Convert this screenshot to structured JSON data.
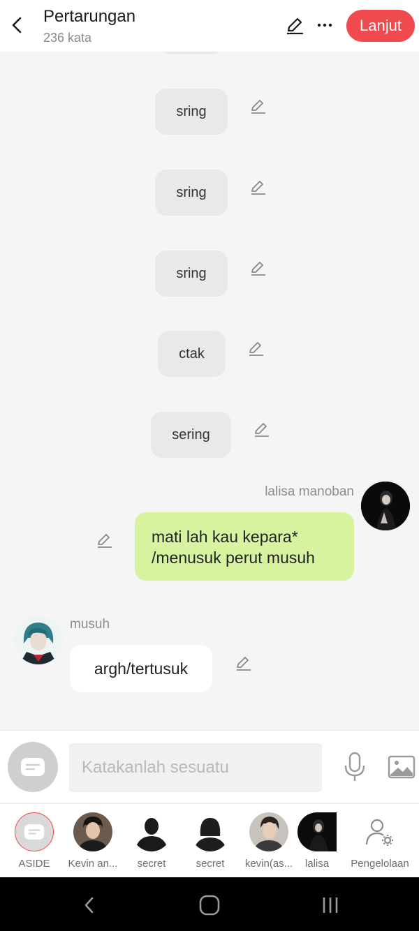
{
  "header": {
    "title": "Pertarungan",
    "word_count": "236 kata",
    "next_label": "Lanjut",
    "accent_color": "#ef4a4e"
  },
  "messages": {
    "sfx": [
      "sring",
      "sring",
      "sring",
      "ctak",
      "sering"
    ],
    "right": {
      "name": "lalisa manoban",
      "text_line1": "mati lah kau kepara*",
      "text_line2": "/menusuk perut musuh",
      "bubble_color": "#d8f3a0"
    },
    "left": {
      "name": "musuh",
      "text": "argh/tertusuk"
    }
  },
  "input": {
    "placeholder": "Katakanlah sesuatu"
  },
  "characters": [
    {
      "label": "ASIDE",
      "icon": "chat-bubble-icon"
    },
    {
      "label": "Kevin an...",
      "icon": "avatar-photo"
    },
    {
      "label": "secret",
      "icon": "silhouette-male"
    },
    {
      "label": "secret",
      "icon": "silhouette-female"
    },
    {
      "label": "kevin(as...",
      "icon": "avatar-photo"
    },
    {
      "label": "lalisa",
      "icon": "avatar-photo"
    },
    {
      "label": "Pengelolaan",
      "icon": "person-gear-icon"
    }
  ]
}
